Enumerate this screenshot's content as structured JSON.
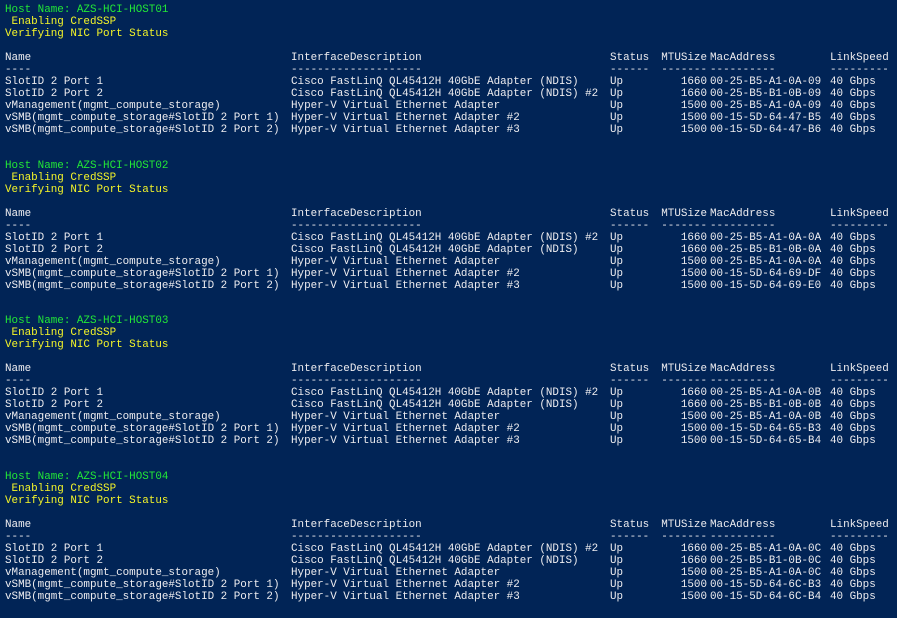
{
  "console": {
    "columns": {
      "name": "Name",
      "desc": "InterfaceDescription",
      "status": "Status",
      "mtu": "MTUSize",
      "mac": "MacAddress",
      "speed": "LinkSpeed"
    },
    "underlines": {
      "name": "----",
      "desc": "--------------------",
      "status": "------",
      "mtu": "-------",
      "mac": "----------",
      "speed": "---------"
    },
    "hosts": [
      {
        "host_line": "Host Name: AZS-HCI-HOST01",
        "credssp_line": " Enabling CredSSP",
        "verify_line": "Verifying NIC Port Status",
        "rows": [
          {
            "name": "SlotID 2 Port 1",
            "desc": "Cisco FastLinQ QL45412H 40GbE Adapter (NDIS)",
            "status": "Up",
            "mtu": "1660",
            "mac": "00-25-B5-A1-0A-09",
            "speed": "40 Gbps"
          },
          {
            "name": "SlotID 2 Port 2",
            "desc": "Cisco FastLinQ QL45412H 40GbE Adapter (NDIS) #2",
            "status": "Up",
            "mtu": "1660",
            "mac": "00-25-B5-B1-0B-09",
            "speed": "40 Gbps"
          },
          {
            "name": "vManagement(mgmt_compute_storage)",
            "desc": "Hyper-V Virtual Ethernet Adapter",
            "status": "Up",
            "mtu": "1500",
            "mac": "00-25-B5-A1-0A-09",
            "speed": "40 Gbps"
          },
          {
            "name": "vSMB(mgmt_compute_storage#SlotID 2 Port 1)",
            "desc": "Hyper-V Virtual Ethernet Adapter #2",
            "status": "Up",
            "mtu": "1500",
            "mac": "00-15-5D-64-47-B5",
            "speed": "40 Gbps"
          },
          {
            "name": "vSMB(mgmt_compute_storage#SlotID 2 Port 2)",
            "desc": "Hyper-V Virtual Ethernet Adapter #3",
            "status": "Up",
            "mtu": "1500",
            "mac": "00-15-5D-64-47-B6",
            "speed": "40 Gbps"
          }
        ]
      },
      {
        "host_line": "Host Name: AZS-HCI-HOST02",
        "credssp_line": " Enabling CredSSP",
        "verify_line": "Verifying NIC Port Status",
        "rows": [
          {
            "name": "SlotID 2 Port 1",
            "desc": "Cisco FastLinQ QL45412H 40GbE Adapter (NDIS) #2",
            "status": "Up",
            "mtu": "1660",
            "mac": "00-25-B5-A1-0A-0A",
            "speed": "40 Gbps"
          },
          {
            "name": "SlotID 2 Port 2",
            "desc": "Cisco FastLinQ QL45412H 40GbE Adapter (NDIS)",
            "status": "Up",
            "mtu": "1660",
            "mac": "00-25-B5-B1-0B-0A",
            "speed": "40 Gbps"
          },
          {
            "name": "vManagement(mgmt_compute_storage)",
            "desc": "Hyper-V Virtual Ethernet Adapter",
            "status": "Up",
            "mtu": "1500",
            "mac": "00-25-B5-A1-0A-0A",
            "speed": "40 Gbps"
          },
          {
            "name": "vSMB(mgmt_compute_storage#SlotID 2 Port 1)",
            "desc": "Hyper-V Virtual Ethernet Adapter #2",
            "status": "Up",
            "mtu": "1500",
            "mac": "00-15-5D-64-69-DF",
            "speed": "40 Gbps"
          },
          {
            "name": "vSMB(mgmt_compute_storage#SlotID 2 Port 2)",
            "desc": "Hyper-V Virtual Ethernet Adapter #3",
            "status": "Up",
            "mtu": "1500",
            "mac": "00-15-5D-64-69-E0",
            "speed": "40 Gbps"
          }
        ]
      },
      {
        "host_line": "Host Name: AZS-HCI-HOST03",
        "credssp_line": " Enabling CredSSP",
        "verify_line": "Verifying NIC Port Status",
        "rows": [
          {
            "name": "SlotID 2 Port 1",
            "desc": "Cisco FastLinQ QL45412H 40GbE Adapter (NDIS) #2",
            "status": "Up",
            "mtu": "1660",
            "mac": "00-25-B5-A1-0A-0B",
            "speed": "40 Gbps"
          },
          {
            "name": "SlotID 2 Port 2",
            "desc": "Cisco FastLinQ QL45412H 40GbE Adapter (NDIS)",
            "status": "Up",
            "mtu": "1660",
            "mac": "00-25-B5-B1-0B-0B",
            "speed": "40 Gbps"
          },
          {
            "name": "vManagement(mgmt_compute_storage)",
            "desc": "Hyper-V Virtual Ethernet Adapter",
            "status": "Up",
            "mtu": "1500",
            "mac": "00-25-B5-A1-0A-0B",
            "speed": "40 Gbps"
          },
          {
            "name": "vSMB(mgmt_compute_storage#SlotID 2 Port 1)",
            "desc": "Hyper-V Virtual Ethernet Adapter #2",
            "status": "Up",
            "mtu": "1500",
            "mac": "00-15-5D-64-65-B3",
            "speed": "40 Gbps"
          },
          {
            "name": "vSMB(mgmt_compute_storage#SlotID 2 Port 2)",
            "desc": "Hyper-V Virtual Ethernet Adapter #3",
            "status": "Up",
            "mtu": "1500",
            "mac": "00-15-5D-64-65-B4",
            "speed": "40 Gbps"
          }
        ]
      },
      {
        "host_line": "Host Name: AZS-HCI-HOST04",
        "credssp_line": " Enabling CredSSP",
        "verify_line": "Verifying NIC Port Status",
        "rows": [
          {
            "name": "SlotID 2 Port 1",
            "desc": "Cisco FastLinQ QL45412H 40GbE Adapter (NDIS) #2",
            "status": "Up",
            "mtu": "1660",
            "mac": "00-25-B5-A1-0A-0C",
            "speed": "40 Gbps"
          },
          {
            "name": "SlotID 2 Port 2",
            "desc": "Cisco FastLinQ QL45412H 40GbE Adapter (NDIS)",
            "status": "Up",
            "mtu": "1660",
            "mac": "00-25-B5-B1-0B-0C",
            "speed": "40 Gbps"
          },
          {
            "name": "vManagement(mgmt_compute_storage)",
            "desc": "Hyper-V Virtual Ethernet Adapter",
            "status": "Up",
            "mtu": "1500",
            "mac": "00-25-B5-A1-0A-0C",
            "speed": "40 Gbps"
          },
          {
            "name": "vSMB(mgmt_compute_storage#SlotID 2 Port 1)",
            "desc": "Hyper-V Virtual Ethernet Adapter #2",
            "status": "Up",
            "mtu": "1500",
            "mac": "00-15-5D-64-6C-B3",
            "speed": "40 Gbps"
          },
          {
            "name": "vSMB(mgmt_compute_storage#SlotID 2 Port 2)",
            "desc": "Hyper-V Virtual Ethernet Adapter #3",
            "status": "Up",
            "mtu": "1500",
            "mac": "00-15-5D-64-6C-B4",
            "speed": "40 Gbps"
          }
        ]
      }
    ]
  }
}
